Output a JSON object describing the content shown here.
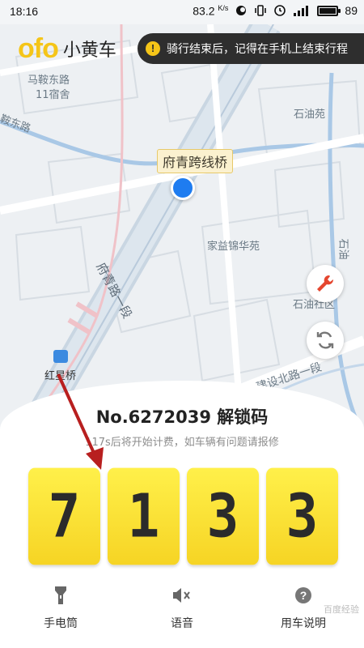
{
  "status_bar": {
    "time": "18:16",
    "speed": "83.2",
    "speed_unit": "K/s",
    "battery_level": 89,
    "battery_text": "89"
  },
  "header": {
    "logo_text": "ofo",
    "brand_name": "小黄车",
    "notice": "骑行结束后，记得在手机上结束行程",
    "notice_icon": "info-icon"
  },
  "map": {
    "labels": {
      "maanhe": "马鞍东路",
      "dorm": "11宿舍",
      "an_road": "鞍东路",
      "shiyou_yuan": "石油苑",
      "fuqing_road": "府青路一段",
      "jiayi": "家益锦华苑",
      "shiyou_right": "石油",
      "shiyou_lower": "石油社区",
      "hongxing": "红星桥",
      "jianshe": "建设北路一段"
    },
    "place_tag": "府青跨线桥",
    "location_color": "#1e7cf0"
  },
  "sheet": {
    "title": "No.6272039 解锁码",
    "subtitle": "117s后将开始计费，如车辆有问题请报修",
    "code_digits": [
      "7",
      "1",
      "3",
      "3"
    ]
  },
  "tools": {
    "flashlight": "手电筒",
    "voice": "语音",
    "guide": "用车说明"
  },
  "watermark": "百度经验",
  "colors": {
    "brand_yellow": "#f5c518",
    "notice_bg": "#2e2e2e",
    "arrow": "#b81f1f",
    "wrench": "#e5462f"
  }
}
